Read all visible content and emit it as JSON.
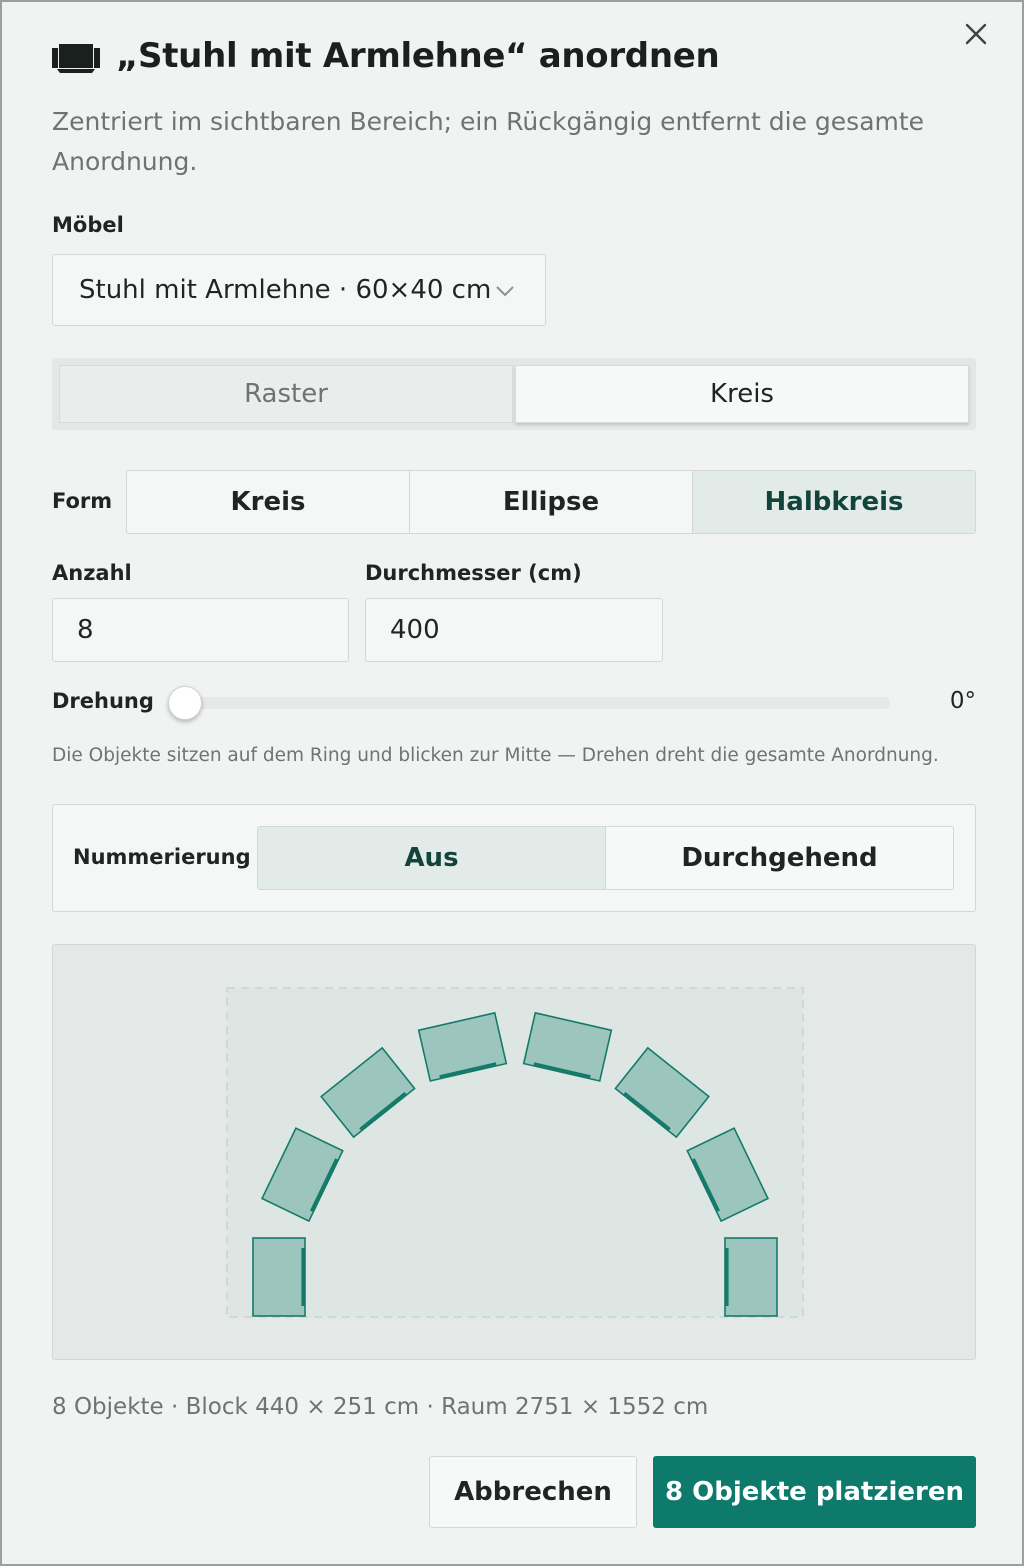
{
  "dialog": {
    "title": "„Stuhl mit Armlehne“ anordnen",
    "subtitle": "Zentriert im sichtbaren Bereich; ein Rückgängig entfernt die gesamte Anordnung.",
    "furniture_label": "Möbel",
    "furniture_selected": "Stuhl mit Armlehne · 60×40 cm",
    "modes": [
      "Raster",
      "Kreis"
    ],
    "active_mode": "Kreis",
    "form_label": "Form",
    "forms": [
      "Kreis",
      "Ellipse",
      "Halbkreis"
    ],
    "active_form": "Halbkreis",
    "count_label": "Anzahl",
    "count_value": "8",
    "diameter_label": "Durchmesser (cm)",
    "diameter_value": "400",
    "rotation_label": "Drehung",
    "rotation_value": "0°",
    "rotation_degrees": 0,
    "hint": "Die Objekte sitzen auf dem Ring und blicken zur Mitte — Drehen dreht die gesamte Anordnung.",
    "numbering_label": "Nummerierung",
    "numbering_options": [
      "Aus",
      "Durchgehend"
    ],
    "numbering_active": "Aus",
    "summary": "8 Objekte · Block 440 × 251 cm · Raum 2751 × 1552 cm",
    "cancel_label": "Abbrechen",
    "confirm_label": "8 Objekte platzieren"
  },
  "colors": {
    "accent": "#0d7a6b",
    "chair_fill": "#9cc5bd",
    "chair_stroke": "#167a6b",
    "active_segment": "#e2ebe8"
  },
  "icons": {
    "title": "sofa-icon",
    "close": "close-icon",
    "dropdown": "chevron-down-icon"
  }
}
